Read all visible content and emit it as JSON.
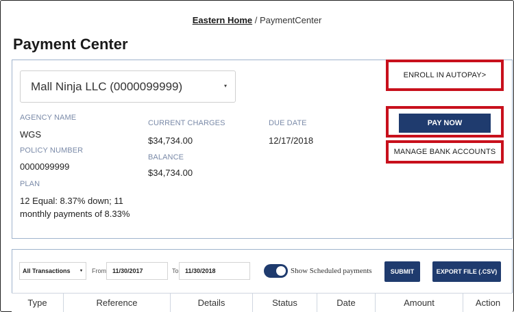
{
  "breadcrumb": {
    "home": "Eastern Home",
    "separator": "/",
    "current": "PaymentCenter"
  },
  "page_title": "Payment Center",
  "account": {
    "selected": "Mall Ninja LLC (0000099999)",
    "caret": "▾"
  },
  "policy": {
    "agency_name_label": "AGENCY NAME",
    "agency_name": "WGS",
    "policy_number_label": "POLICY NUMBER",
    "policy_number": "0000099999",
    "plan_label": "PLAN",
    "plan_line1": "12 Equal: 8.37% down; 11",
    "plan_line2": "monthly payments of 8.33%",
    "current_charges_label": "CURRENT CHARGES",
    "current_charges": "$34,734.00",
    "balance_label": "BALANCE",
    "balance": "$34,734.00",
    "due_date_label": "DUE DATE",
    "due_date": "12/17/2018"
  },
  "actions": {
    "enroll_autopay": "ENROLL IN AUTOPAY>",
    "pay_now": "PAY NOW",
    "manage_bank": "MANAGE BANK ACCOUNTS"
  },
  "filters": {
    "transaction_type": "All Transactions",
    "caret": "▾",
    "from_label": "From",
    "from_date": "11/30/2017",
    "to_label": "To",
    "to_date": "11/30/2018",
    "show_scheduled_label": "Show Scheduled payments",
    "show_scheduled_on": true,
    "submit": "SUBMIT",
    "export": "EXPORT FILE (.CSV)"
  },
  "table": {
    "columns": [
      "Type",
      "Reference",
      "Details",
      "Status",
      "Date",
      "Amount",
      "Action"
    ]
  },
  "colors": {
    "primary": "#1f3b6e",
    "highlight": "#c8101c",
    "label": "#7a8aa8",
    "border": "#9fb3cc"
  }
}
